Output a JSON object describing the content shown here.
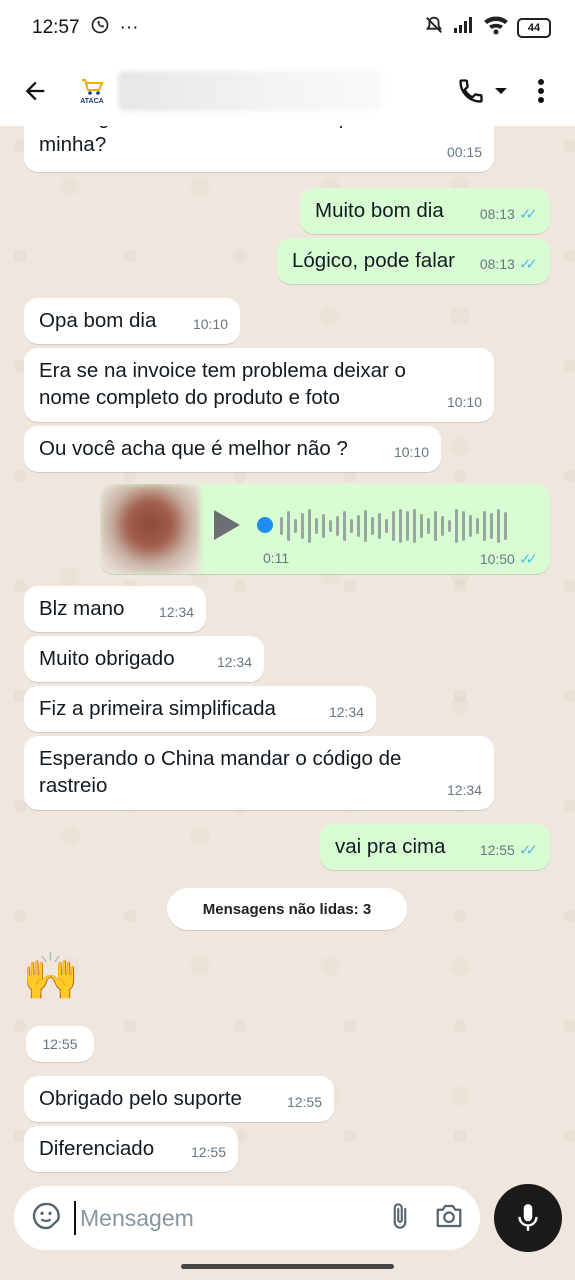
{
  "status_bar": {
    "time": "12:57",
    "overflow_dots": "···",
    "battery": "44"
  },
  "header": {
    "avatar_text": "ATACA"
  },
  "messages": [
    {
      "dir": "in",
      "text": "Consegue sanar uma dúvida simples minha?",
      "time": "00:15"
    },
    {
      "dir": "out",
      "text": "Muito bom dia",
      "time": "08:13"
    },
    {
      "dir": "out",
      "text": "Lógico, pode falar",
      "time": "08:13"
    },
    {
      "dir": "in",
      "text": "Opa bom dia",
      "time": "10:10"
    },
    {
      "dir": "in",
      "text": "Era se na invoice tem problema deixar o nome completo do produto e foto",
      "time": "10:10"
    },
    {
      "dir": "in",
      "text": "Ou você acha que é melhor não ?",
      "time": "10:10"
    },
    {
      "dir": "in",
      "text": "Blz mano",
      "time": "12:34"
    },
    {
      "dir": "in",
      "text": "Muito obrigado",
      "time": "12:34"
    },
    {
      "dir": "in",
      "text": "Fiz a primeira simplificada",
      "time": "12:34"
    },
    {
      "dir": "in",
      "text": "Esperando o China mandar o código de rastreio",
      "time": "12:34"
    },
    {
      "dir": "out",
      "text": "vai pra cima",
      "time": "12:55"
    },
    {
      "dir": "in",
      "text": "🙌",
      "time": "12:55"
    },
    {
      "dir": "in",
      "text": "Obrigado pelo suporte",
      "time": "12:55"
    },
    {
      "dir": "in",
      "text": "Diferenciado",
      "time": "12:55"
    }
  ],
  "voice_note": {
    "duration": "0:11",
    "time": "10:50"
  },
  "unread_banner": "Mensagens não lidas: 3",
  "input": {
    "placeholder": "Mensagem"
  },
  "colors": {
    "chat_background": "#efe7dd",
    "incoming_bubble": "#ffffff",
    "outgoing_bubble": "#d9fdd3",
    "read_ticks": "#53bdeb",
    "mic_button": "#1a1a1a"
  },
  "icons": [
    "back-arrow-icon",
    "phone-icon",
    "dropdown-caret-icon",
    "more-vert-icon",
    "play-icon",
    "sticker-icon",
    "attach-icon",
    "camera-icon",
    "mic-icon",
    "whatsapp-icon",
    "mute-icon",
    "signal-icon",
    "wifi-icon"
  ]
}
